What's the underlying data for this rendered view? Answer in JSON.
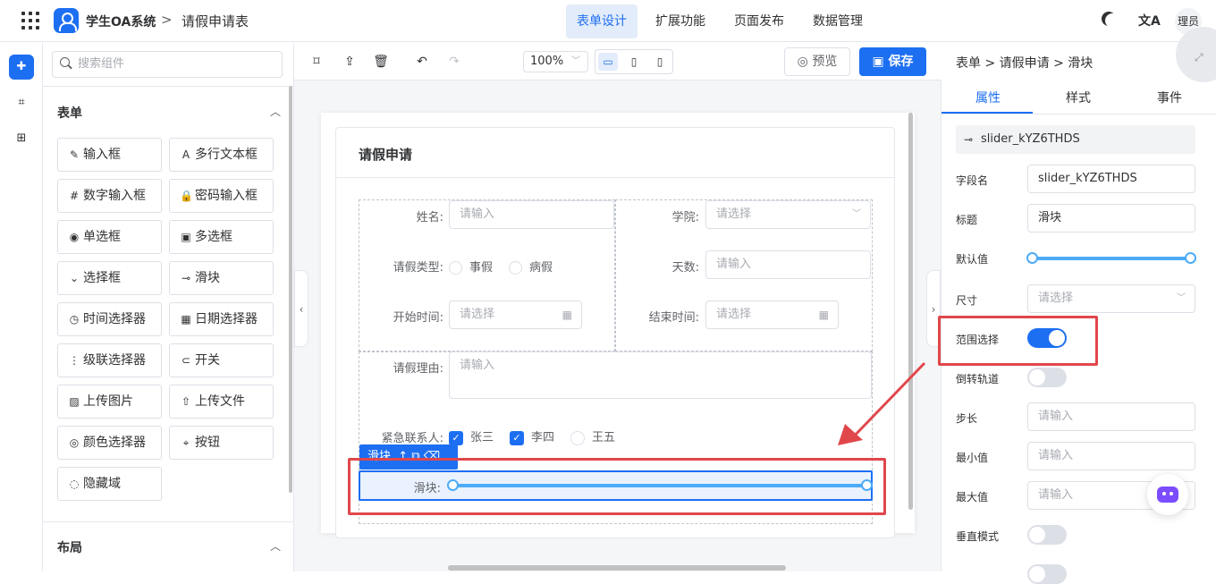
{
  "app": {
    "name": "学生OA系统",
    "breadcrumb_sep": ">",
    "page": "请假申请表"
  },
  "nav": [
    {
      "label": "表单设计",
      "active": true
    },
    {
      "label": "扩展功能",
      "active": false
    },
    {
      "label": "页面发布",
      "active": false
    },
    {
      "label": "数据管理",
      "active": false
    }
  ],
  "header_right": {
    "lang_icon": "文A",
    "user": "理员"
  },
  "components": {
    "search_placeholder": "搜索组件",
    "section_form": "表单",
    "section_layout": "布局",
    "items": [
      {
        "label": "输入框",
        "icon": "✎"
      },
      {
        "label": "多行文本框",
        "icon": "A"
      },
      {
        "label": "数字输入框",
        "icon": "#"
      },
      {
        "label": "密码输入框",
        "icon": "🔒"
      },
      {
        "label": "单选框",
        "icon": "◉"
      },
      {
        "label": "多选框",
        "icon": "▣"
      },
      {
        "label": "选择框",
        "icon": "⌄"
      },
      {
        "label": "滑块",
        "icon": "⊸"
      },
      {
        "label": "时间选择器",
        "icon": "◷"
      },
      {
        "label": "日期选择器",
        "icon": "▦"
      },
      {
        "label": "级联选择器",
        "icon": "⋮"
      },
      {
        "label": "开关",
        "icon": "⊂"
      },
      {
        "label": "上传图片",
        "icon": "▨"
      },
      {
        "label": "上传文件",
        "icon": "⇧"
      },
      {
        "label": "颜色选择器",
        "icon": "◎"
      },
      {
        "label": "按钮",
        "icon": "⌖"
      },
      {
        "label": "隐藏域",
        "icon": "◌"
      }
    ]
  },
  "toolbar": {
    "zoom": "100%",
    "preview": "预览",
    "save": "保存"
  },
  "form": {
    "title": "请假申请",
    "name_label": "姓名:",
    "name_placeholder": "请输入",
    "college_label": "学院:",
    "college_placeholder": "请选择",
    "type_label": "请假类型:",
    "type_options": [
      "事假",
      "病假"
    ],
    "days_label": "天数:",
    "days_placeholder": "请输入",
    "start_label": "开始时间:",
    "start_placeholder": "请选择",
    "end_label": "结束时间:",
    "end_placeholder": "请选择",
    "reason_label": "请假理由:",
    "reason_placeholder": "请输入",
    "contact_label": "紧急联系人:",
    "contacts": [
      {
        "name": "张三",
        "checked": true
      },
      {
        "name": "李四",
        "checked": true
      },
      {
        "name": "王五",
        "checked": false
      }
    ],
    "slider_tag": "滑块",
    "slider_label": "滑块:",
    "slider_range": [
      0,
      100
    ]
  },
  "props": {
    "breadcrumb": "表单 > 请假申请 > 滑块",
    "tabs": [
      "属性",
      "样式",
      "事件"
    ],
    "component_id": "slider_kYZ6THDS",
    "field_label": "字段名",
    "field_value": "slider_kYZ6THDS",
    "title_label": "标题",
    "title_value": "滑块",
    "default_label": "默认值",
    "default_range": [
      0,
      100
    ],
    "size_label": "尺寸",
    "size_placeholder": "请选择",
    "range_label": "范围选择",
    "range_on": true,
    "reverse_label": "倒转轨道",
    "reverse_on": false,
    "step_label": "步长",
    "step_placeholder": "请输入",
    "min_label": "最小值",
    "min_placeholder": "请输入",
    "max_label": "最大值",
    "max_placeholder": "请输入",
    "vertical_label": "垂直模式",
    "vertical_on": false
  },
  "colors": {
    "primary": "#1d6ff2",
    "highlight": "#e0474b",
    "slider": "#4dabf7"
  }
}
